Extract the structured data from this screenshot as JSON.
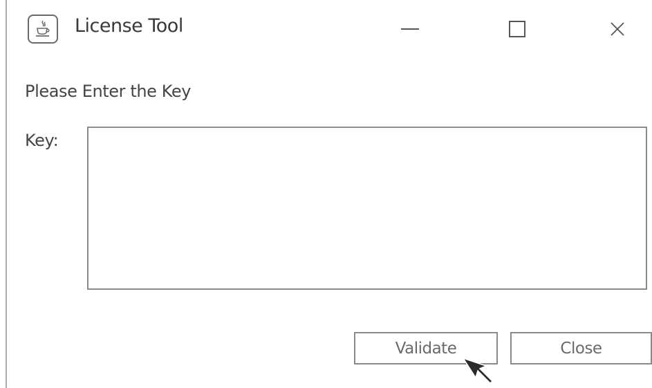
{
  "window": {
    "title": "License Tool",
    "icon": "java-cup-icon"
  },
  "window_controls": {
    "minimize_icon": "minimize-icon",
    "maximize_icon": "maximize-icon",
    "close_icon": "close-icon",
    "close_glyph": "✕"
  },
  "form": {
    "prompt": "Please Enter the Key",
    "key_label": "Key:",
    "key_value": ""
  },
  "buttons": {
    "validate_label": "Validate",
    "close_label": "Close"
  },
  "colors": {
    "border": "#8a8a8a",
    "text": "#444444",
    "button_text": "#6a6a6a"
  }
}
